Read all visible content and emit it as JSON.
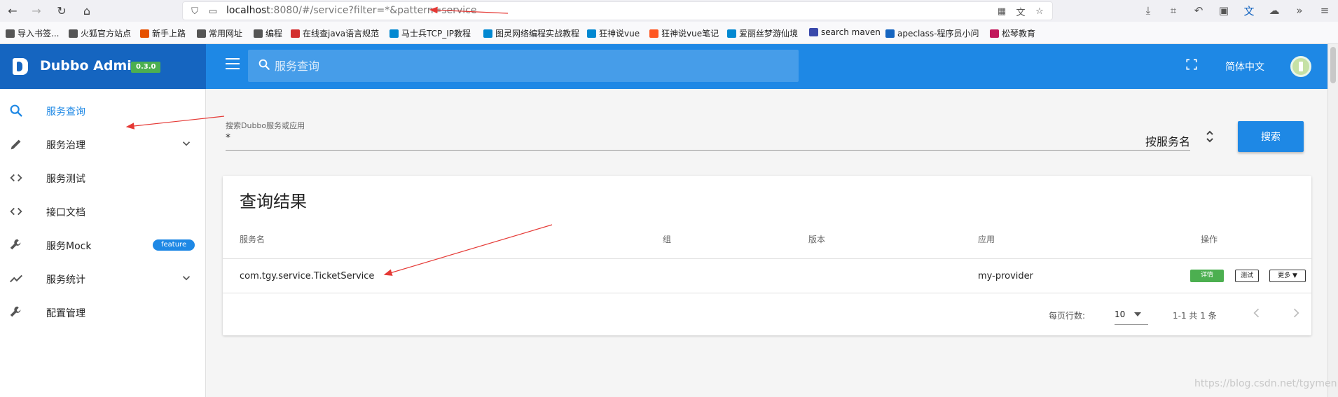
{
  "browser": {
    "url_host": "localhost",
    "url_rest": ":8080/#/service?filter=*&pattern=service",
    "bookmarks": [
      {
        "label": "导入书签...",
        "color": "#555555"
      },
      {
        "label": "火狐官方站点",
        "color": "#555555"
      },
      {
        "label": "新手上路",
        "color": "#e65100"
      },
      {
        "label": "常用网址",
        "color": "#555555"
      },
      {
        "label": "编程",
        "color": "#555555"
      },
      {
        "label": "在线查java语言规范",
        "color": "#d32f2f"
      },
      {
        "label": "马士兵TCP_IP教程",
        "color": "#0288d1"
      },
      {
        "label": "图灵网络编程实战教程",
        "color": "#0288d1"
      },
      {
        "label": "狂神说vue",
        "color": "#0288d1"
      },
      {
        "label": "狂神说vue笔记",
        "color": "#ff5722"
      },
      {
        "label": "爱丽丝梦游仙境",
        "color": "#0288d1"
      },
      {
        "label": "search maven",
        "color": "#3949ab"
      },
      {
        "label": "apeclass-程序员小问",
        "color": "#1565c0"
      },
      {
        "label": "松琴教育",
        "color": "#c2185b"
      }
    ]
  },
  "header": {
    "brand": "Dubbo Admin",
    "version": "0.3.0",
    "search_placeholder": "服务查询",
    "language": "简体中文"
  },
  "sidebar": {
    "items": [
      {
        "label": "服务查询",
        "icon": "search-icon",
        "active": true
      },
      {
        "label": "服务治理",
        "icon": "pencil-icon",
        "expandable": true
      },
      {
        "label": "服务测试",
        "icon": "code-icon"
      },
      {
        "label": "接口文档",
        "icon": "code-icon"
      },
      {
        "label": "服务Mock",
        "icon": "wrench-icon",
        "badge": "feature"
      },
      {
        "label": "服务统计",
        "icon": "trend-icon",
        "expandable": true
      },
      {
        "label": "配置管理",
        "icon": "wrench-icon"
      }
    ]
  },
  "search": {
    "caption": "搜索Dubbo服务或应用",
    "value": "*",
    "mode": "按服务名",
    "button": "搜索"
  },
  "results": {
    "title": "查询结果",
    "columns": [
      "服务名",
      "组",
      "版本",
      "应用",
      "操作"
    ],
    "rows": [
      {
        "service": "com.tgy.service.TicketService",
        "group": "",
        "version": "",
        "app": "my-provider"
      }
    ],
    "actions": {
      "detail": "详情",
      "test": "测试",
      "more": "更多 ▼"
    },
    "pager": {
      "label": "每页行数:",
      "rows_per_page": "10",
      "range": "1-1 共 1 条"
    }
  },
  "watermark": "https://blog.csdn.net/tgymen",
  "colors": {
    "primary": "#1e88e5",
    "primary_dark": "#1565c0",
    "success": "#4caf50",
    "annotation": "#e53935"
  }
}
